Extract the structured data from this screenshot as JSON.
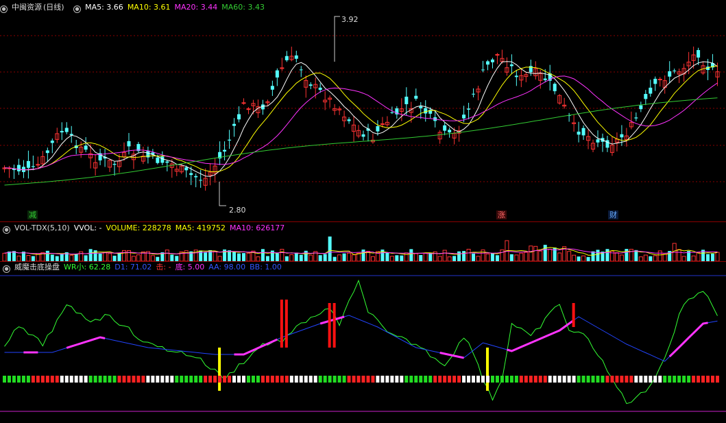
{
  "main_header": {
    "stock_name": "中闽资源",
    "period": "(日线)",
    "indicators": [
      {
        "label": "MA5: 3.66",
        "color": "#ffffff"
      },
      {
        "label": "MA10: 3.61",
        "color": "#ffff00"
      },
      {
        "label": "MA20: 3.44",
        "color": "#ff33ff"
      },
      {
        "label": "MA60: 3.43",
        "color": "#33cc33"
      }
    ]
  },
  "price_annotations": {
    "high": "3.92",
    "low": "2.80"
  },
  "event_marks": [
    {
      "text": "减",
      "color": "#33cc33",
      "bg": "#003300"
    },
    {
      "text": "涨",
      "color": "#ff6666",
      "bg": "#330000"
    },
    {
      "text": "财",
      "color": "#66aaff",
      "bg": "#001133"
    }
  ],
  "volume_header": {
    "title": "VOL-TDX(5,10)",
    "items": [
      {
        "label": "VVOL: -",
        "color": "#ffffff"
      },
      {
        "label": "VOLUME: 228278",
        "color": "#ffff00"
      },
      {
        "label": "MA5: 419752",
        "color": "#ffff00"
      },
      {
        "label": "MA10: 626177",
        "color": "#ff33ff"
      }
    ]
  },
  "indicator_header": {
    "title": "威魔击底操盘",
    "items": [
      {
        "label": "WR小: 62.28",
        "color": "#33ff33"
      },
      {
        "label": "D1: 71.02",
        "color": "#3355ff"
      },
      {
        "label": "击: -",
        "color": "#ff3333"
      },
      {
        "label": "底: 5.00",
        "color": "#ff33ff"
      },
      {
        "label": "AA: 98.00",
        "color": "#3355ff"
      },
      {
        "label": "BB: 1.00",
        "color": "#3355ff"
      }
    ]
  },
  "colors": {
    "up": "#ff3333",
    "down": "#54ffff",
    "ma5": "#ffffff",
    "ma10": "#ffff00",
    "ma20": "#ff33ff",
    "ma60": "#33cc33",
    "grid": "#8b0000"
  }
}
